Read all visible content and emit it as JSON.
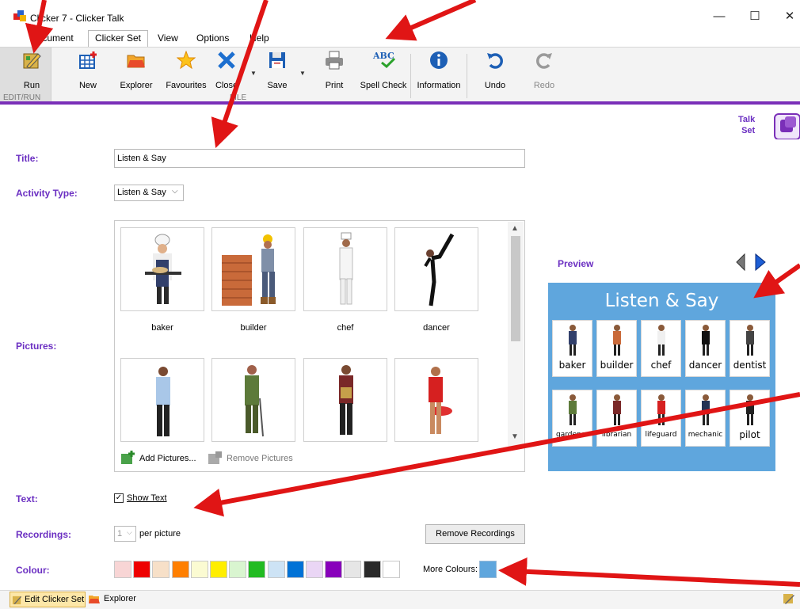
{
  "window": {
    "title": "Clicker 7 - Clicker Talk",
    "minimize": "—",
    "maximize": "☐",
    "close": "✕"
  },
  "menu": {
    "items": [
      "Document",
      "Clicker Set",
      "View",
      "Options",
      "Help"
    ]
  },
  "ribbon": {
    "buttons": [
      "Run",
      "New",
      "Explorer",
      "Favourites",
      "Close",
      "Save",
      "Print",
      "Spell Check",
      "Information",
      "Undo",
      "Redo"
    ],
    "groups": [
      "EDIT/RUN",
      "FILE"
    ],
    "spell_check_icon_text": "ABC"
  },
  "talk_set": {
    "line1": "Talk",
    "line2": "Set"
  },
  "form": {
    "title_label": "Title:",
    "title_value": "Listen & Say",
    "activity_label": "Activity Type:",
    "activity_value": "Listen & Say",
    "pictures_label": "Pictures:",
    "pictures": [
      "baker",
      "builder",
      "chef",
      "dancer"
    ],
    "add_pictures": "Add Pictures...",
    "remove_pictures": "Remove Pictures",
    "text_label": "Text:",
    "show_text": "Show Text",
    "show_text_checked": true,
    "recordings_label": "Recordings:",
    "recordings_value": "1",
    "per_picture": "per picture",
    "remove_recordings": "Remove Recordings",
    "colour_label": "Colour:",
    "more_colours": "More Colours:",
    "swatches": [
      "#f8d5d5",
      "#ee0000",
      "#f7e0c8",
      "#ff7f00",
      "#fbfbd2",
      "#ffee00",
      "#d9f5d0",
      "#22bb22",
      "#cde3f5",
      "#0072d6",
      "#ead6f5",
      "#8800bb",
      "#e6e6e6",
      "#2a2a2a",
      "#ffffff"
    ],
    "selected_colour": "#5fa6dd"
  },
  "preview": {
    "label": "Preview",
    "title": "Listen & Say",
    "row1": [
      "baker",
      "builder",
      "chef",
      "dancer",
      "dentist"
    ],
    "row2": [
      "gardener",
      "librarian",
      "lifeguard",
      "mechanic",
      "pilot"
    ]
  },
  "status": {
    "edit_tab": "Edit Clicker Set",
    "explorer_tab": "Explorer"
  }
}
